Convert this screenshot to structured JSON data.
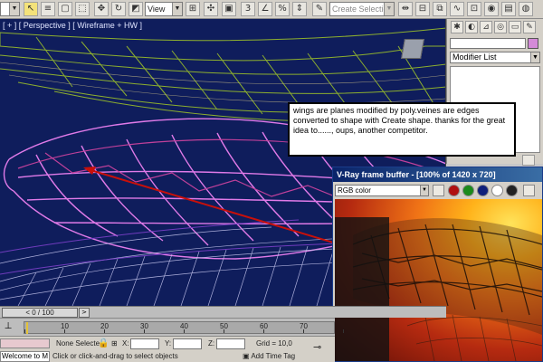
{
  "toolbar": {
    "view_combo": "View",
    "selection_set_combo": "Create Selection Se",
    "icons": [
      "undo-icon",
      "select-icon",
      "select-region-icon",
      "select-by-name-icon",
      "move-icon",
      "rotate-icon",
      "scale-icon",
      "reference-coord-icon",
      "pivot-icon",
      "select-manipulate-icon",
      "snap-icon",
      "angle-snap-icon",
      "percent-snap-icon",
      "spinner-snap-icon",
      "named-selection-icon",
      "mirror-icon",
      "align-icon",
      "layer-icon",
      "curve-editor-icon",
      "schematic-icon",
      "material-editor-icon",
      "render-setup-icon",
      "render-icon",
      "quick-render-icon"
    ]
  },
  "viewport": {
    "label": "[ + ] [ Perspective ] [ Wireframe + HW ]",
    "background": "#0f1d5c"
  },
  "command_panel": {
    "modifier_list": "Modifier List",
    "object_color": "#d48ad8"
  },
  "annotation": {
    "text": "wings are planes modified by poly.veines are edges converted to shape with Create shape. thanks for the great idea to......, oups, another competitor."
  },
  "vray": {
    "title": "V-Ray frame buffer - [100% of 1420 x 720]",
    "channel": "RGB color"
  },
  "timeline": {
    "position": "0 / 100",
    "ticks": [
      "10",
      "20",
      "30",
      "40",
      "50",
      "60",
      "70"
    ]
  },
  "status": {
    "selection": "None Selecte",
    "x_label": "X:",
    "y_label": "Y:",
    "z_label": "Z:",
    "grid": "Grid = 10,0",
    "prompt": "Click or click-and-drag to select objects",
    "add_time_tag": "Add Time Tag",
    "welcome": "Welcome to M"
  }
}
